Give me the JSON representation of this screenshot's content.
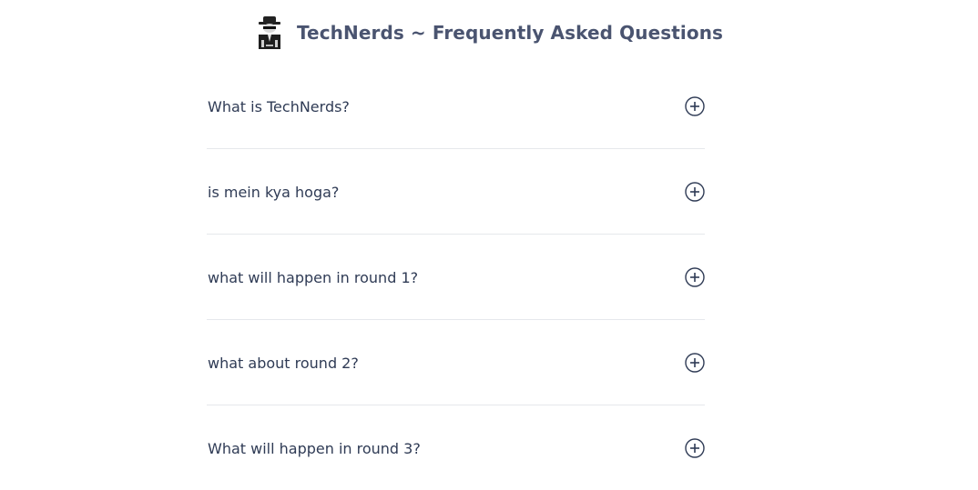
{
  "header": {
    "logo_icon": "spy-logo-icon",
    "title": "TechNerds ~ Frequently Asked Questions"
  },
  "faq": {
    "toggle_icon": "plus-circle-icon",
    "items": [
      {
        "question": "What is TechNerds?"
      },
      {
        "question": "is mein kya hoga?"
      },
      {
        "question": "what will happen in round 1?"
      },
      {
        "question": "what about round 2?"
      },
      {
        "question": "What will happen in round 3?"
      }
    ]
  },
  "colors": {
    "text": "#2f3b55",
    "title": "#4a5470",
    "divider": "#e6e8ec"
  }
}
